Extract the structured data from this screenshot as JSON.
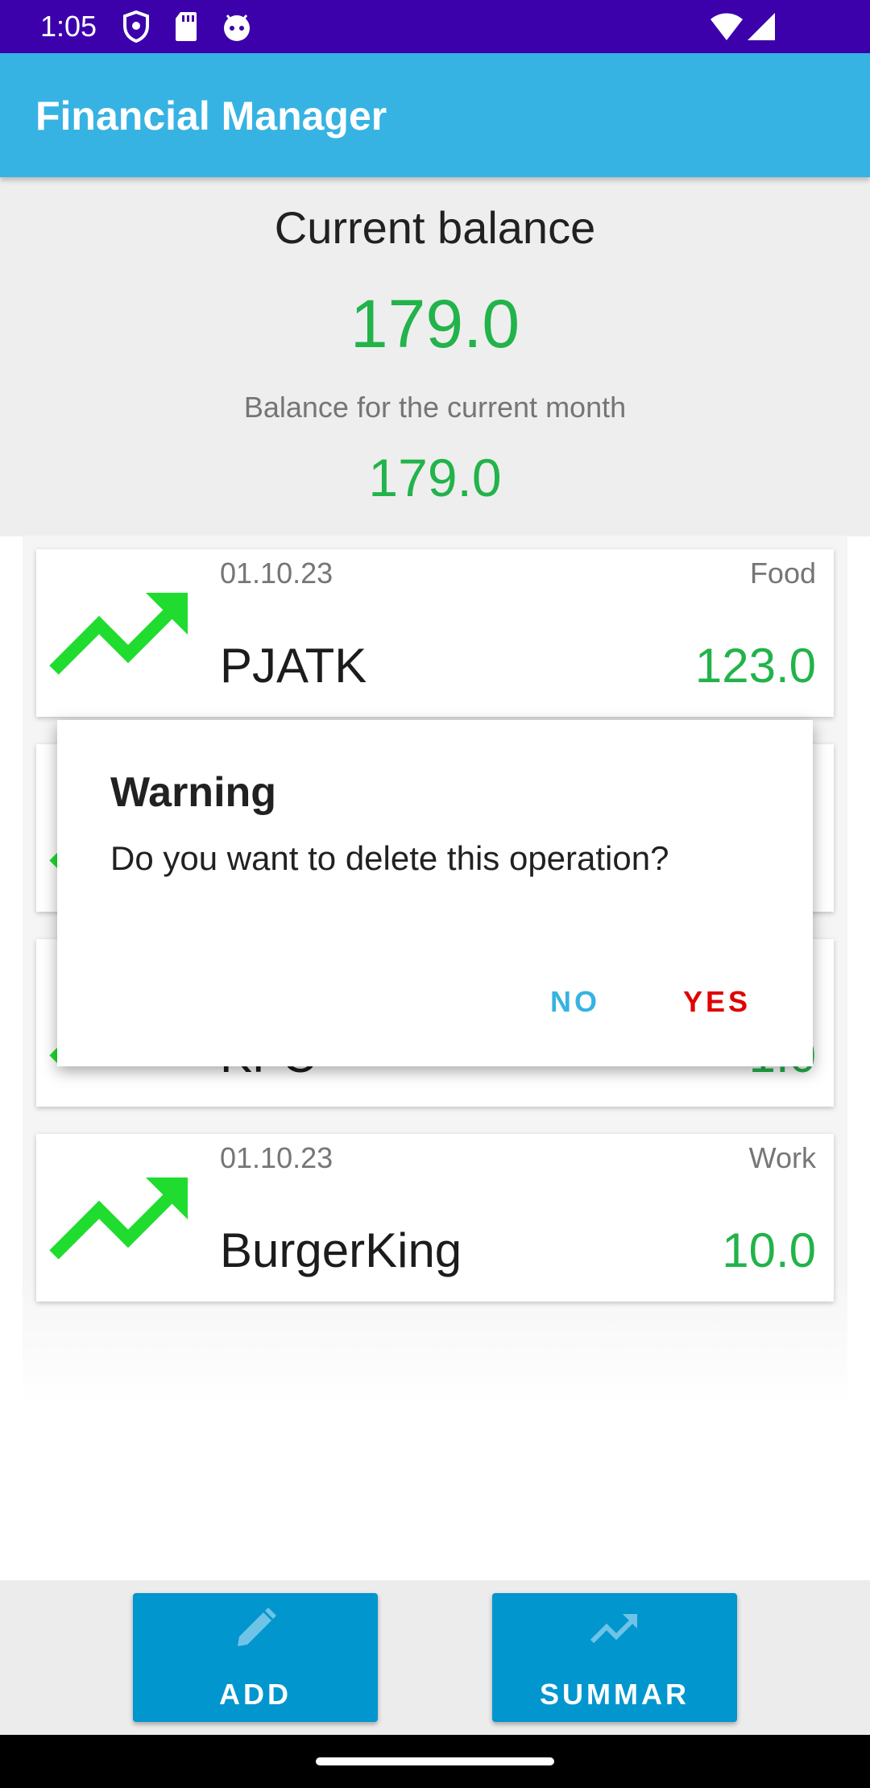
{
  "status_bar": {
    "time": "1:05",
    "icons": [
      "shield-icon",
      "sd-card-icon",
      "android-icon",
      "wifi-icon",
      "cellular-signal-icon"
    ]
  },
  "app_bar": {
    "title": "Financial Manager"
  },
  "balance": {
    "label": "Current balance",
    "value": "179.0",
    "month_label": "Balance for the current month",
    "month_value": "179.0",
    "value_color": "#22b34a"
  },
  "operations": [
    {
      "date": "01.10.23",
      "category": "Food",
      "name": "PJATK",
      "amount": "123.0",
      "icon": "trending-up-icon"
    },
    {
      "date": "",
      "category": "",
      "name": "",
      "amount": "",
      "icon": "trending-up-icon"
    },
    {
      "date": "",
      "category": "",
      "name": "KFC",
      "amount": "1.0",
      "icon": "trending-up-icon"
    },
    {
      "date": "01.10.23",
      "category": "Work",
      "name": "BurgerKing",
      "amount": "10.0",
      "icon": "trending-up-icon"
    }
  ],
  "dialog": {
    "title": "Warning",
    "message": "Do you want to delete this operation?",
    "no_label": "NO",
    "yes_label": "YES",
    "no_color": "#36b3e3",
    "yes_color": "#e00000"
  },
  "bottom_bar": {
    "add_label": "ADD",
    "add_icon": "pencil-icon",
    "summary_label": "SUMMAR",
    "summary_icon": "trending-up-icon"
  },
  "colors": {
    "status_bar": "#3c01ab",
    "app_bar": "#36b3e3",
    "button": "#0296cf",
    "income": "#22b34a",
    "arrow": "#1fdc2f"
  }
}
